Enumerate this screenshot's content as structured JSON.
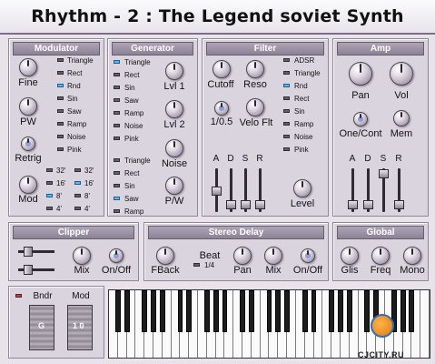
{
  "title": "Rhythm - 2 : The Legend soviet Synth",
  "watermark": "CJCITY.RU",
  "modulator": {
    "header": "Modulator",
    "knobs": [
      "Fine",
      "PW",
      "Retrig",
      "Mod"
    ],
    "waves": [
      "Triangle",
      "Rect",
      "Rnd",
      "Sin",
      "Saw",
      "Ramp",
      "Noise",
      "Pink"
    ],
    "feet_left": [
      "32'",
      "16'",
      "8'",
      "4'"
    ],
    "feet_right": [
      "32'",
      "16'",
      "8'",
      "4'"
    ]
  },
  "generator": {
    "header": "Generator",
    "waves1": [
      "Triangle",
      "Rect",
      "Sin",
      "Saw",
      "Ramp",
      "Noise",
      "Pink"
    ],
    "waves2": [
      "Triangle",
      "Rect",
      "Sin",
      "Saw",
      "Ramp"
    ],
    "knobs": [
      "Lvl 1",
      "Lvl 2",
      "Noise",
      "P/W"
    ]
  },
  "filter": {
    "header": "Filter",
    "knobs": [
      "Cutoff",
      "Reso",
      "1/0.5",
      "Velo Flt",
      "Level"
    ],
    "modes": [
      "ADSR",
      "Triangle",
      "Rnd",
      "Rect",
      "Sin",
      "Ramp",
      "Noise",
      "Pink"
    ],
    "adsr": [
      "A",
      "D",
      "S",
      "R"
    ]
  },
  "amp": {
    "header": "Amp",
    "knobs": [
      "Pan",
      "Vol",
      "One/Cont",
      "Mem"
    ],
    "adsr": [
      "A",
      "D",
      "S",
      "R"
    ]
  },
  "clipper": {
    "header": "Clipper",
    "knobs": [
      "Mix",
      "On/Off"
    ]
  },
  "stereo_delay": {
    "header": "Stereo Delay",
    "knobs": [
      "FBack",
      "Pan",
      "Mix",
      "On/Off"
    ],
    "beat_label": "Beat",
    "beat_value": "1/4"
  },
  "global": {
    "header": "Global",
    "knobs": [
      "Glis",
      "Freq",
      "Mono"
    ]
  },
  "wheels": {
    "bender_label": "Bndr",
    "mod_label": "Mod",
    "bender_letter": "G",
    "mod_letter": "1 0"
  },
  "colors": {
    "led_on": "#58b8ff",
    "led_off": "#626068",
    "panel_header": "#9b91a5",
    "background": "#e8e3ea"
  }
}
